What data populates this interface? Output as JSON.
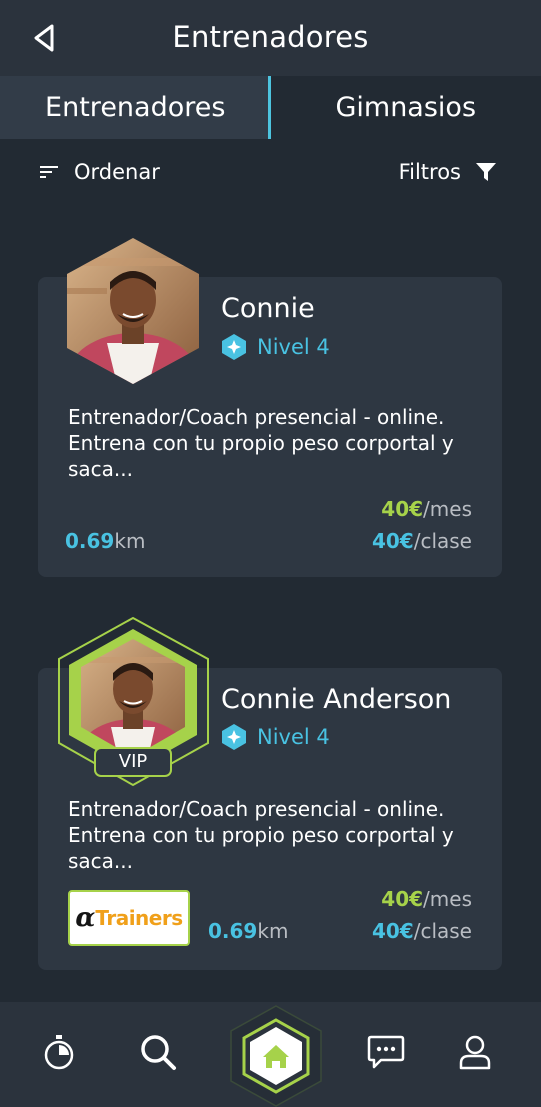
{
  "header": {
    "title": "Entrenadores"
  },
  "tabs": [
    {
      "label": "Entrenadores",
      "active": true
    },
    {
      "label": "Gimnasios",
      "active": false
    }
  ],
  "toolbar": {
    "sort_label": "Ordenar",
    "filter_label": "Filtros"
  },
  "trainers": [
    {
      "name": "Connie",
      "level": "Nivel 4",
      "description": "Entrenador/Coach presencial - online. Entrena con tu propio peso corportal y saca...",
      "price_month": "40€",
      "price_month_unit": "/mes",
      "price_class": "40€",
      "price_class_unit": "/clase",
      "distance": "0.69",
      "distance_unit": "km",
      "vip": false
    },
    {
      "name": "Connie Anderson",
      "level": "Nivel 4",
      "badge": "VIP",
      "description": "Entrenador/Coach presencial - online. Entrena con tu propio peso corportal y saca...",
      "price_month": "40€",
      "price_month_unit": "/mes",
      "price_class": "40€",
      "price_class_unit": "/clase",
      "distance": "0.69",
      "distance_unit": "km",
      "vip": true,
      "gym_logo_alpha": "α",
      "gym_logo_text": "Trainers"
    }
  ],
  "colors": {
    "accent_blue": "#49c2e2",
    "accent_green": "#a6d24a",
    "background": "#222a33",
    "card": "#2e3742"
  },
  "bottom_nav": [
    {
      "icon": "stopwatch-icon"
    },
    {
      "icon": "search-icon"
    },
    {
      "icon": "home-icon",
      "active": true
    },
    {
      "icon": "chat-icon"
    },
    {
      "icon": "profile-icon"
    }
  ]
}
